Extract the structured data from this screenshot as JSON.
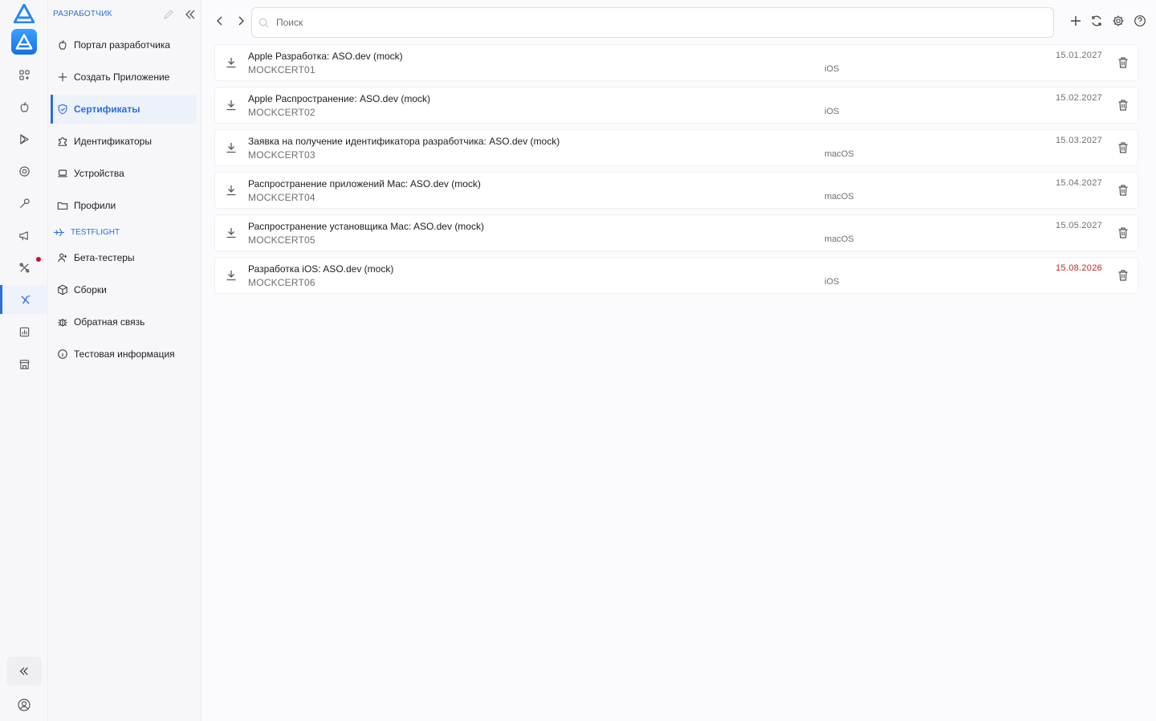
{
  "rail": {
    "accent": "#2a6fdb",
    "items": [
      {
        "icon": "apps-grid-icon"
      },
      {
        "icon": "apple-icon"
      },
      {
        "icon": "play-store-icon"
      },
      {
        "icon": "eye-icon"
      },
      {
        "icon": "wrench-icon"
      },
      {
        "icon": "megaphone-icon"
      },
      {
        "icon": "tools-icon",
        "has_notification": true
      },
      {
        "icon": "xcode-icon",
        "active": true
      },
      {
        "icon": "analytics-icon"
      },
      {
        "icon": "store-icon"
      }
    ]
  },
  "sidebar": {
    "header": "РАЗРАБОТЧИК",
    "items": [
      {
        "label": "Портал разработчика",
        "icon": "apple-icon"
      },
      {
        "label": "Создать Приложение",
        "icon": "plus-icon"
      },
      {
        "label": "Сертификаты",
        "icon": "shield-check-icon",
        "active": true
      },
      {
        "label": "Идентификаторы",
        "icon": "puzzle-icon"
      },
      {
        "label": "Устройства",
        "icon": "laptop-icon"
      },
      {
        "label": "Профили",
        "icon": "folder-icon"
      }
    ],
    "section": "TESTFLIGHT",
    "testflight_items": [
      {
        "label": "Бета-тестеры",
        "icon": "add-user-icon"
      },
      {
        "label": "Сборки",
        "icon": "box-icon"
      },
      {
        "label": "Обратная связь",
        "icon": "bug-icon"
      },
      {
        "label": "Тестовая информация",
        "icon": "info-icon"
      }
    ]
  },
  "search": {
    "placeholder": "Поиск",
    "value": ""
  },
  "certificates": [
    {
      "name": "Apple Разработка: ASO.dev (mock)",
      "serial": "MOCKCERT01",
      "platform": "iOS",
      "expires": "15.01.2027",
      "expiring": false
    },
    {
      "name": "Apple Распространение: ASO.dev (mock)",
      "serial": "MOCKCERT02",
      "platform": "iOS",
      "expires": "15.02.2027",
      "expiring": false
    },
    {
      "name": "Заявка на получение идентификатора разработчика: ASO.dev (mock)",
      "serial": "MOCKCERT03",
      "platform": "macOS",
      "expires": "15.03.2027",
      "expiring": false
    },
    {
      "name": "Распространение приложений Mac: ASO.dev (mock)",
      "serial": "MOCKCERT04",
      "platform": "macOS",
      "expires": "15.04.2027",
      "expiring": false
    },
    {
      "name": "Распространение установщика Mac: ASO.dev (mock)",
      "serial": "MOCKCERT05",
      "platform": "macOS",
      "expires": "15.05.2027",
      "expiring": false
    },
    {
      "name": "Разработка iOS: ASO.dev (mock)",
      "serial": "MOCKCERT06",
      "platform": "iOS",
      "expires": "15.08.2026",
      "expiring": true
    }
  ],
  "colors": {
    "accent": "#2a6fdb",
    "expiring": "#c0262d"
  }
}
